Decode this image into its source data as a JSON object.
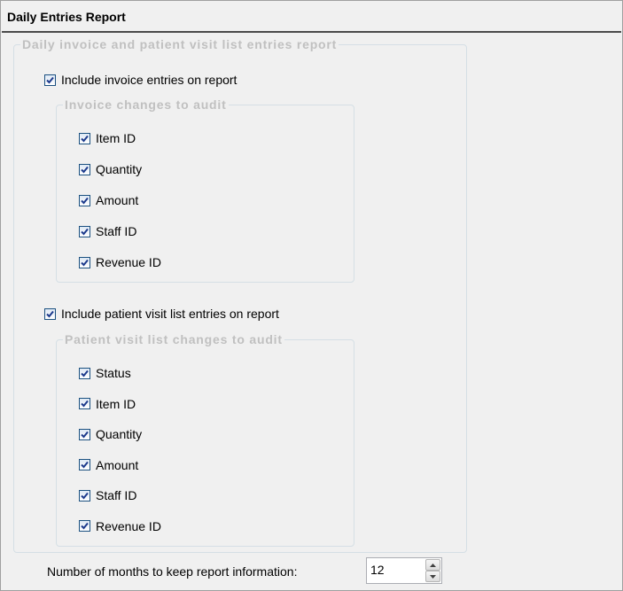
{
  "header": {
    "title": "Daily Entries Report"
  },
  "group_main": {
    "legend": "Daily invoice and patient visit list entries report"
  },
  "include_invoice": {
    "label": "Include invoice entries on report",
    "checked": true
  },
  "invoice_audit": {
    "legend": "Invoice changes to audit",
    "items": [
      {
        "label": "Item ID",
        "checked": true
      },
      {
        "label": "Quantity",
        "checked": true
      },
      {
        "label": "Amount",
        "checked": true
      },
      {
        "label": "Staff ID",
        "checked": true
      },
      {
        "label": "Revenue ID",
        "checked": true
      }
    ]
  },
  "include_visit": {
    "label": "Include patient visit list entries on report",
    "checked": true
  },
  "visit_audit": {
    "legend": "Patient visit list changes to audit",
    "items": [
      {
        "label": "Status",
        "checked": true
      },
      {
        "label": "Item ID",
        "checked": true
      },
      {
        "label": "Quantity",
        "checked": true
      },
      {
        "label": "Amount",
        "checked": true
      },
      {
        "label": "Staff ID",
        "checked": true
      },
      {
        "label": "Revenue ID",
        "checked": true
      }
    ]
  },
  "retention": {
    "label": "Number of months to keep report information:",
    "value": "12"
  },
  "colors": {
    "check": "#1c3a8c",
    "group_border": "#d5dfe5",
    "legend_text": "#c0c0c0"
  }
}
